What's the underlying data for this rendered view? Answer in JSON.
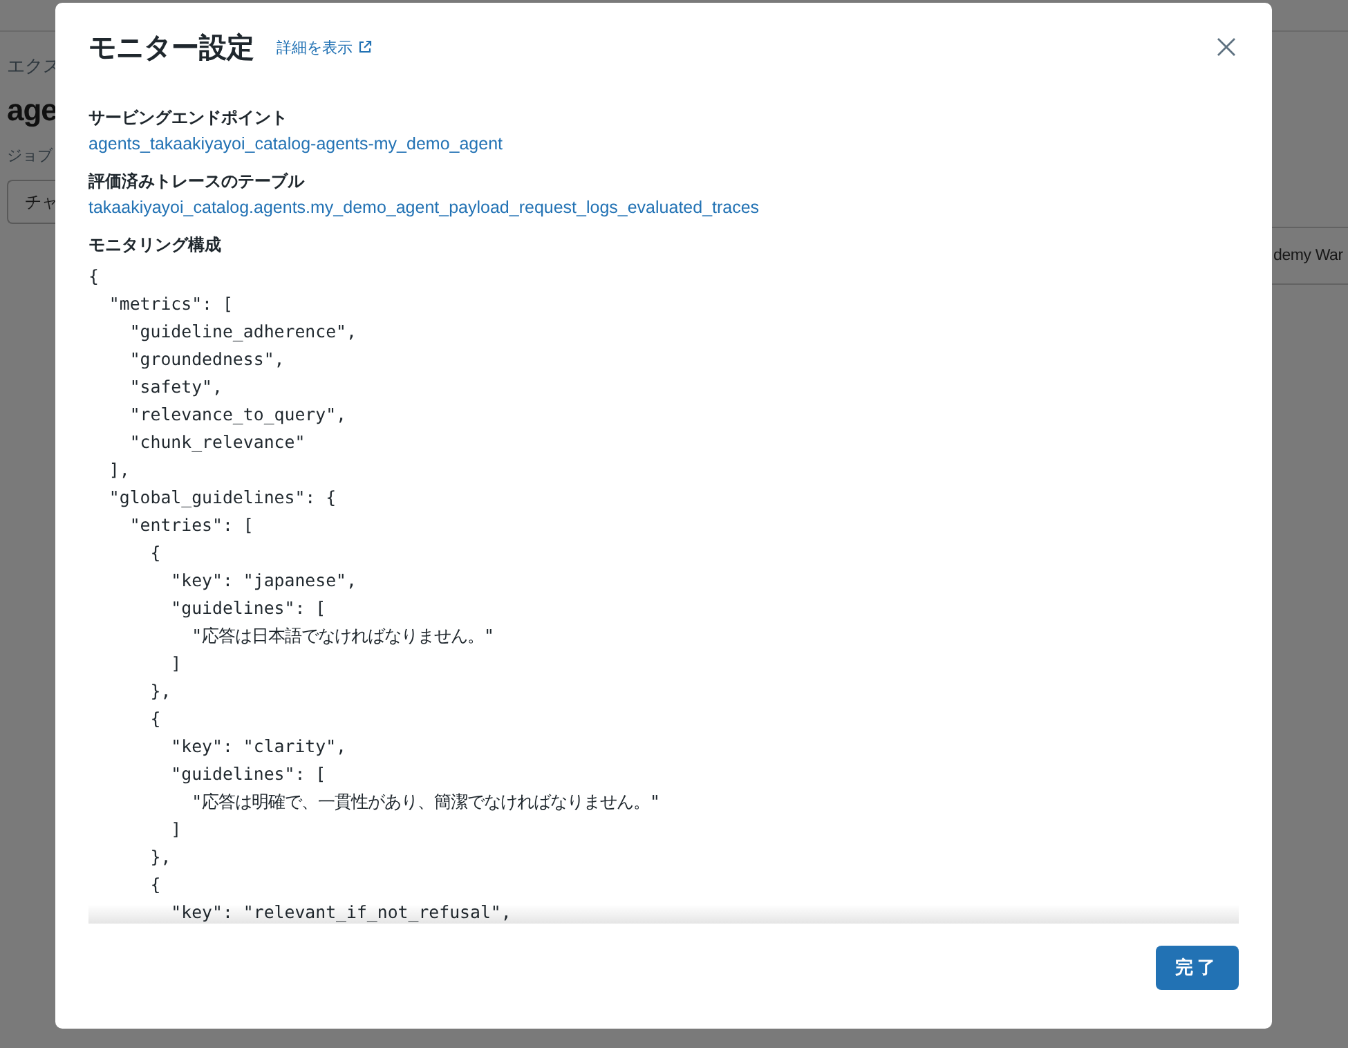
{
  "background": {
    "breadcrumb": "エクス",
    "page_title": "age",
    "section_label": "ジョブ",
    "button": "チャ",
    "right_cell": "demy War"
  },
  "dialog": {
    "title": "モニター設定",
    "details_link": "詳細を表示",
    "fields": [
      {
        "label": "サービングエンドポイント",
        "value": "agents_takaakiyayoi_catalog-agents-my_demo_agent"
      },
      {
        "label": "評価済みトレースのテーブル",
        "value": "takaakiyayoi_catalog.agents.my_demo_agent_payload_request_logs_evaluated_traces"
      }
    ],
    "config_label": "モニタリング構成",
    "config_lines": [
      "{",
      "  \"metrics\": [",
      "    \"guideline_adherence\",",
      "    \"groundedness\",",
      "    \"safety\",",
      "    \"relevance_to_query\",",
      "    \"chunk_relevance\"",
      "  ],",
      "  \"global_guidelines\": {",
      "    \"entries\": [",
      "      {",
      "        \"key\": \"japanese\",",
      "        \"guidelines\": [",
      "          \"応答は日本語でなければなりません。\"",
      "        ]",
      "      },",
      "      {",
      "        \"key\": \"clarity\",",
      "        \"guidelines\": [",
      "          \"応答は明確で、一貫性があり、簡潔でなければなりません。\"",
      "        ]",
      "      },",
      "      {",
      "        \"key\": \"relevant_if_not_refusal\","
    ],
    "done_button": "完了"
  }
}
